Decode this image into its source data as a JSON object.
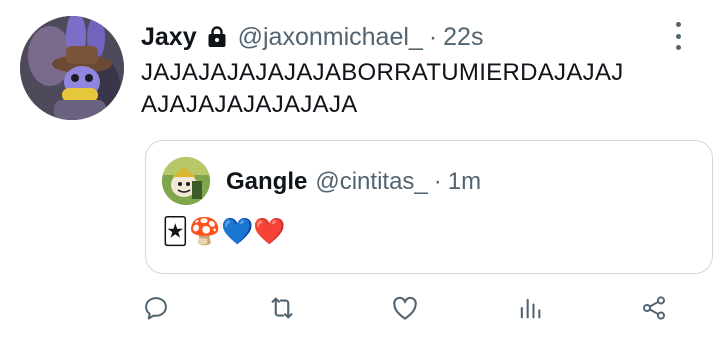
{
  "tweet": {
    "author_name": "Jaxy",
    "author_handle": "@jaxonmichael_",
    "separator": "·",
    "time": "22s",
    "text_lines": [
      "JAJAJAJAJAJAJABORRATUMIERDAJAJAJ",
      "AJAJAJAJAJAJAJA"
    ],
    "icons": {
      "locked": "lock-icon",
      "more": "more-vertical-icon"
    }
  },
  "quoted_tweet": {
    "author_name": "Gangle",
    "author_handle": "@cintitas_",
    "separator": "·",
    "time": "1m",
    "emojis": [
      "🃏",
      "🍄",
      "💙",
      "❤️"
    ]
  },
  "actions": {
    "icons": [
      "reply-icon",
      "retweet-icon",
      "like-icon",
      "analytics-icon",
      "share-icon"
    ]
  },
  "colors": {
    "text_primary": "#0f1419",
    "text_secondary": "#536471",
    "border": "#cfd9de"
  }
}
